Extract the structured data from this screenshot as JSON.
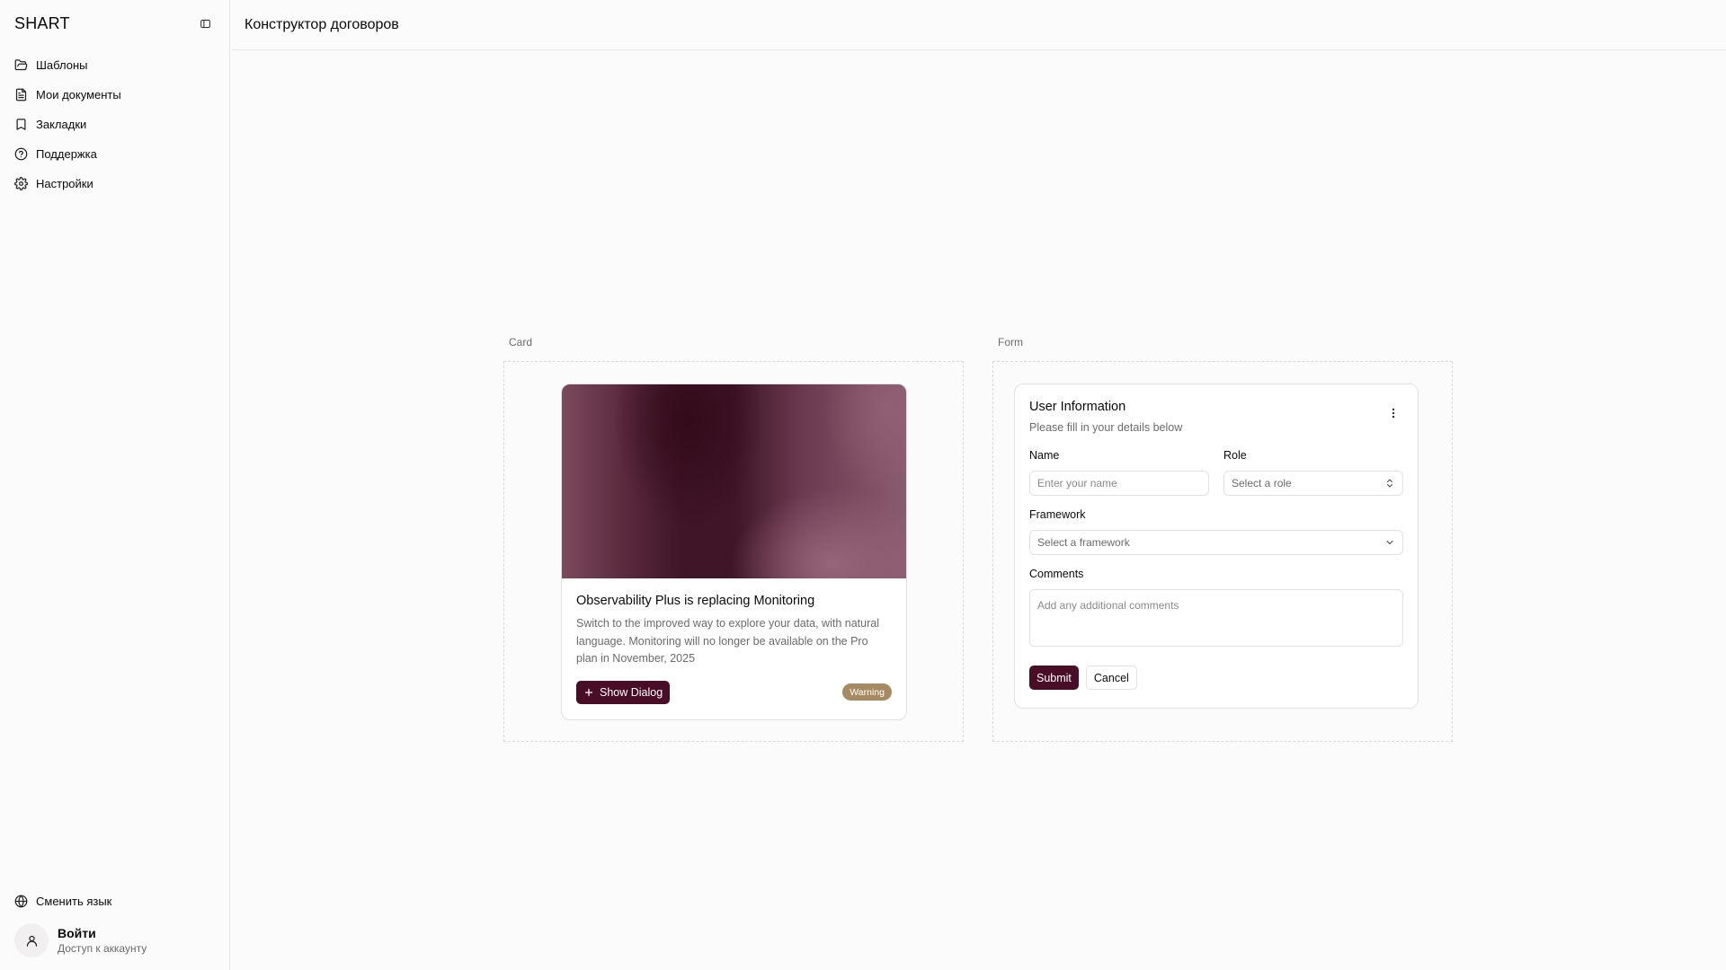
{
  "sidebar": {
    "brand": "SHART",
    "items": [
      {
        "label": "Шаблоны",
        "icon": "folder-open-icon"
      },
      {
        "label": "Мои документы",
        "icon": "file-text-icon"
      },
      {
        "label": "Закладки",
        "icon": "bookmark-icon"
      },
      {
        "label": "Поддержка",
        "icon": "help-circle-icon"
      },
      {
        "label": "Настройки",
        "icon": "gear-icon"
      }
    ],
    "language_label": "Сменить язык",
    "account": {
      "title": "Войти",
      "subtitle": "Доступ к аккаунту"
    }
  },
  "header": {
    "title": "Конструктор договоров"
  },
  "sections": {
    "card_label": "Card",
    "form_label": "Form"
  },
  "card": {
    "title": "Observability Plus is replacing Monitoring",
    "description": "Switch to the improved way to explore your data, with natural language. Monitoring will no longer be available on the Pro plan in November, 2025",
    "button_label": "Show Dialog",
    "badge": "Warning"
  },
  "form": {
    "title": "User Information",
    "subtitle": "Please fill in your details below",
    "name_label": "Name",
    "name_placeholder": "Enter your name",
    "role_label": "Role",
    "role_placeholder": "Select a role",
    "framework_label": "Framework",
    "framework_placeholder": "Select a framework",
    "comments_label": "Comments",
    "comments_placeholder": "Add any additional comments",
    "submit_label": "Submit",
    "cancel_label": "Cancel"
  },
  "colors": {
    "accent": "#4a0d27",
    "badge": "#a88a62",
    "border": "#e3e0e0",
    "background": "#fcfbfb"
  }
}
